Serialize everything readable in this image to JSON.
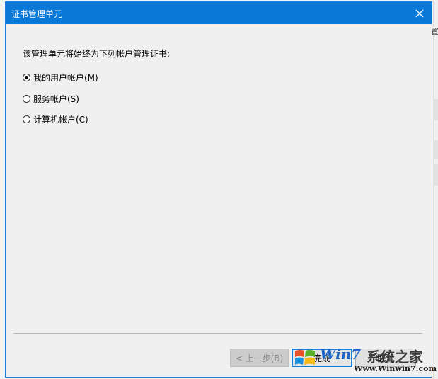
{
  "dialog": {
    "title": "证书管理单元",
    "prompt": "该管理单元将始终为下列帐户管理证书:",
    "options": [
      {
        "label": "我的用户帐户(M)",
        "checked": true
      },
      {
        "label": "服务帐户(S)",
        "checked": false
      },
      {
        "label": "计算机帐户(C)",
        "checked": false
      }
    ],
    "buttons": {
      "back": "< 上一步(B)",
      "finish": "完成",
      "cancel": "取消"
    }
  },
  "background": {
    "mark_top": "置"
  },
  "watermark": {
    "win_text": "Win7",
    "cn_text": "系统之家",
    "url": "Www.Winwin7.com"
  },
  "colors": {
    "titlebar": "#0a78d7",
    "dialog_bg": "#f0f0f0",
    "accent": "#1a7fd4"
  },
  "icons": {
    "close": "close-icon",
    "watermark_logo": "windows-logo-icon"
  }
}
